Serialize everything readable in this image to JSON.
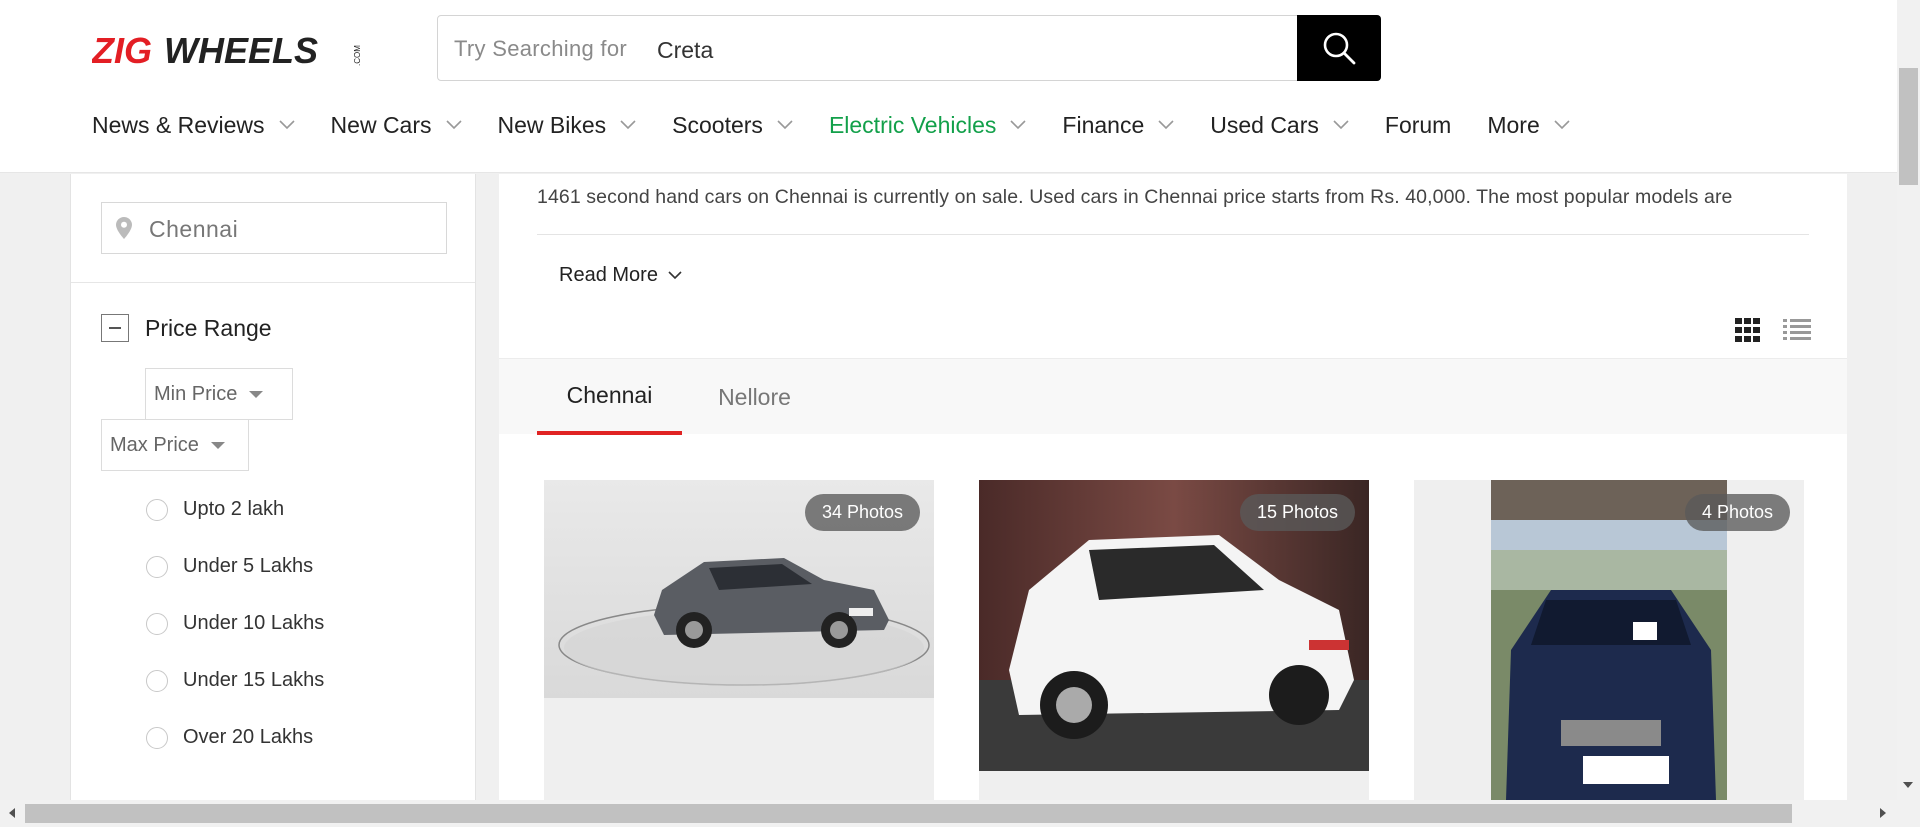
{
  "header": {
    "logo_text": "ZIGWHEELS.COM",
    "search": {
      "placeholder": "Try Searching for",
      "value": "Creta"
    },
    "nav": [
      {
        "label": "News & Reviews",
        "has_dropdown": true
      },
      {
        "label": "New Cars",
        "has_dropdown": true
      },
      {
        "label": "New Bikes",
        "has_dropdown": true
      },
      {
        "label": "Scooters",
        "has_dropdown": true
      },
      {
        "label": "Electric Vehicles",
        "has_dropdown": true,
        "color": "#12a04a"
      },
      {
        "label": "Finance",
        "has_dropdown": true
      },
      {
        "label": "Used Cars",
        "has_dropdown": true
      },
      {
        "label": "Forum",
        "has_dropdown": false
      },
      {
        "label": "More",
        "has_dropdown": true
      }
    ]
  },
  "sidebar": {
    "city_value": "Chennai",
    "price_range": {
      "title": "Price Range",
      "min_label": "Min Price",
      "max_label": "Max Price",
      "options": [
        "Upto 2 lakh",
        "Under 5 Lakhs",
        "Under 10 Lakhs",
        "Under 15 Lakhs",
        "Over 20 Lakhs"
      ]
    }
  },
  "main": {
    "description": "1461 second hand cars on Chennai is currently on sale. Used cars in Chennai price starts from Rs. 40,000. The most popular models are",
    "read_more": "Read More",
    "tabs": [
      {
        "label": "Chennai",
        "active": true
      },
      {
        "label": "Nellore",
        "active": false
      }
    ],
    "cards": [
      {
        "photos": "34 Photos"
      },
      {
        "photos": "15 Photos"
      },
      {
        "photos": "4 Photos"
      }
    ]
  },
  "colors": {
    "accent_red": "#e02323",
    "ev_green": "#12a04a",
    "logo_red": "#e31e24"
  }
}
